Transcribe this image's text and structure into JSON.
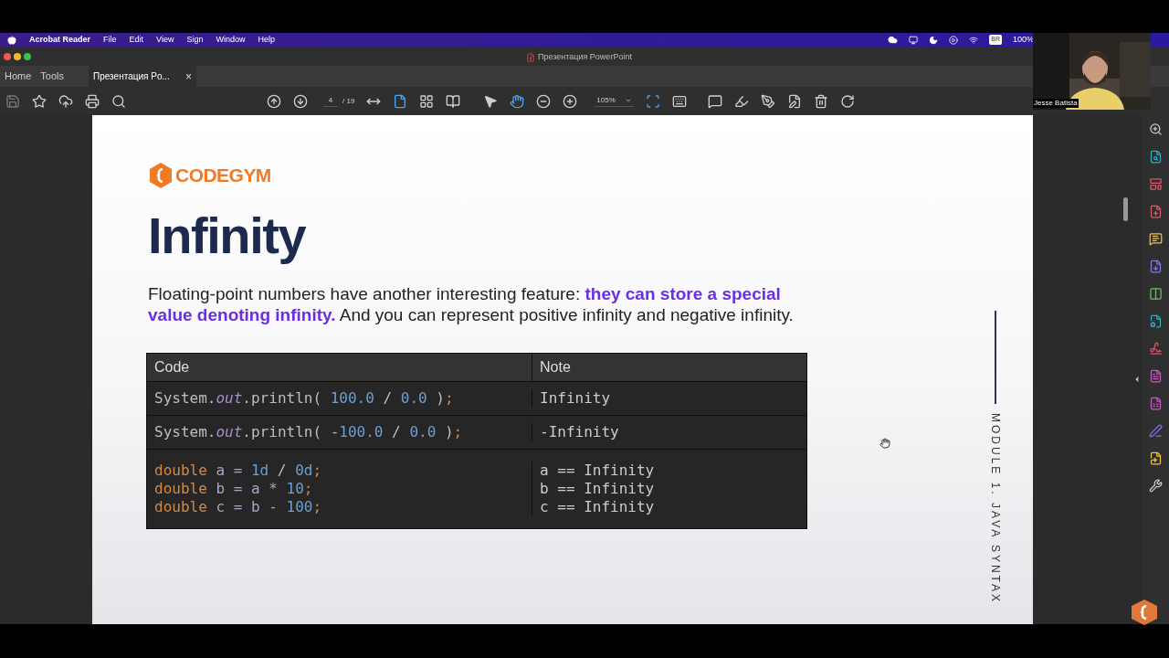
{
  "menu_bar": {
    "app_name": "Acrobat Reader",
    "items": [
      "File",
      "Edit",
      "View",
      "Sign",
      "Window",
      "Help"
    ],
    "battery": "100%",
    "user_badge": "BR"
  },
  "window": {
    "title": "Презентация PowerPoint"
  },
  "tabs": [
    {
      "label": "Home",
      "selected": false
    },
    {
      "label": "Tools",
      "selected": false
    },
    {
      "label": "Презентация Po...",
      "selected": true,
      "closable": true
    }
  ],
  "close_glyph": "×",
  "toolbar": {
    "page": "4",
    "page_total": "/ 19",
    "zoom": "105%"
  },
  "slide": {
    "logo": "CODEGYM",
    "title": "Infinity",
    "paragraph": "Floating-point numbers have another interesting feature: **they can store a special value denoting infinity.** And you can represent positive infinity and negative infinity.",
    "side_label": "MODULE 1. JAVA SYNTAX",
    "table": {
      "columns": [
        "Code",
        "Note"
      ],
      "rows": [
        {
          "code": [
            [
              {
                "kind": "plain",
                "text": "System."
              },
              {
                "kind": "field",
                "text": "out"
              },
              {
                "kind": "plain",
                "text": ".println( "
              },
              {
                "kind": "number",
                "text": "100.0"
              },
              {
                "kind": "plain",
                "text": " / "
              },
              {
                "kind": "number",
                "text": "0.0"
              },
              {
                "kind": "plain",
                "text": " )"
              },
              {
                "kind": "semi",
                "text": ";"
              }
            ]
          ],
          "note": [
            "Infinity"
          ]
        },
        {
          "code": [
            [
              {
                "kind": "plain",
                "text": "System."
              },
              {
                "kind": "field",
                "text": "out"
              },
              {
                "kind": "plain",
                "text": ".println( -"
              },
              {
                "kind": "number",
                "text": "100.0"
              },
              {
                "kind": "plain",
                "text": " / "
              },
              {
                "kind": "number",
                "text": "0.0"
              },
              {
                "kind": "plain",
                "text": " )"
              },
              {
                "kind": "semi",
                "text": ";"
              }
            ]
          ],
          "note": [
            "-Infinity"
          ]
        },
        {
          "code": [
            [
              {
                "kind": "keyword",
                "text": "double "
              },
              {
                "kind": "var",
                "text": "a = "
              },
              {
                "kind": "number",
                "text": "1d"
              },
              {
                "kind": "plain",
                "text": " / "
              },
              {
                "kind": "number",
                "text": "0d"
              },
              {
                "kind": "semi",
                "text": ";"
              }
            ],
            [
              {
                "kind": "keyword",
                "text": "double "
              },
              {
                "kind": "var",
                "text": "b = a * "
              },
              {
                "kind": "number",
                "text": "10"
              },
              {
                "kind": "semi",
                "text": ";"
              }
            ],
            [
              {
                "kind": "keyword",
                "text": "double "
              },
              {
                "kind": "var",
                "text": "c = b - "
              },
              {
                "kind": "number",
                "text": "100"
              },
              {
                "kind": "semi",
                "text": ";"
              }
            ]
          ],
          "note": [
            "a == Infinity",
            "b == Infinity",
            "c == Infinity"
          ]
        }
      ]
    }
  },
  "webcam": {
    "name": "Jesse Batista"
  }
}
